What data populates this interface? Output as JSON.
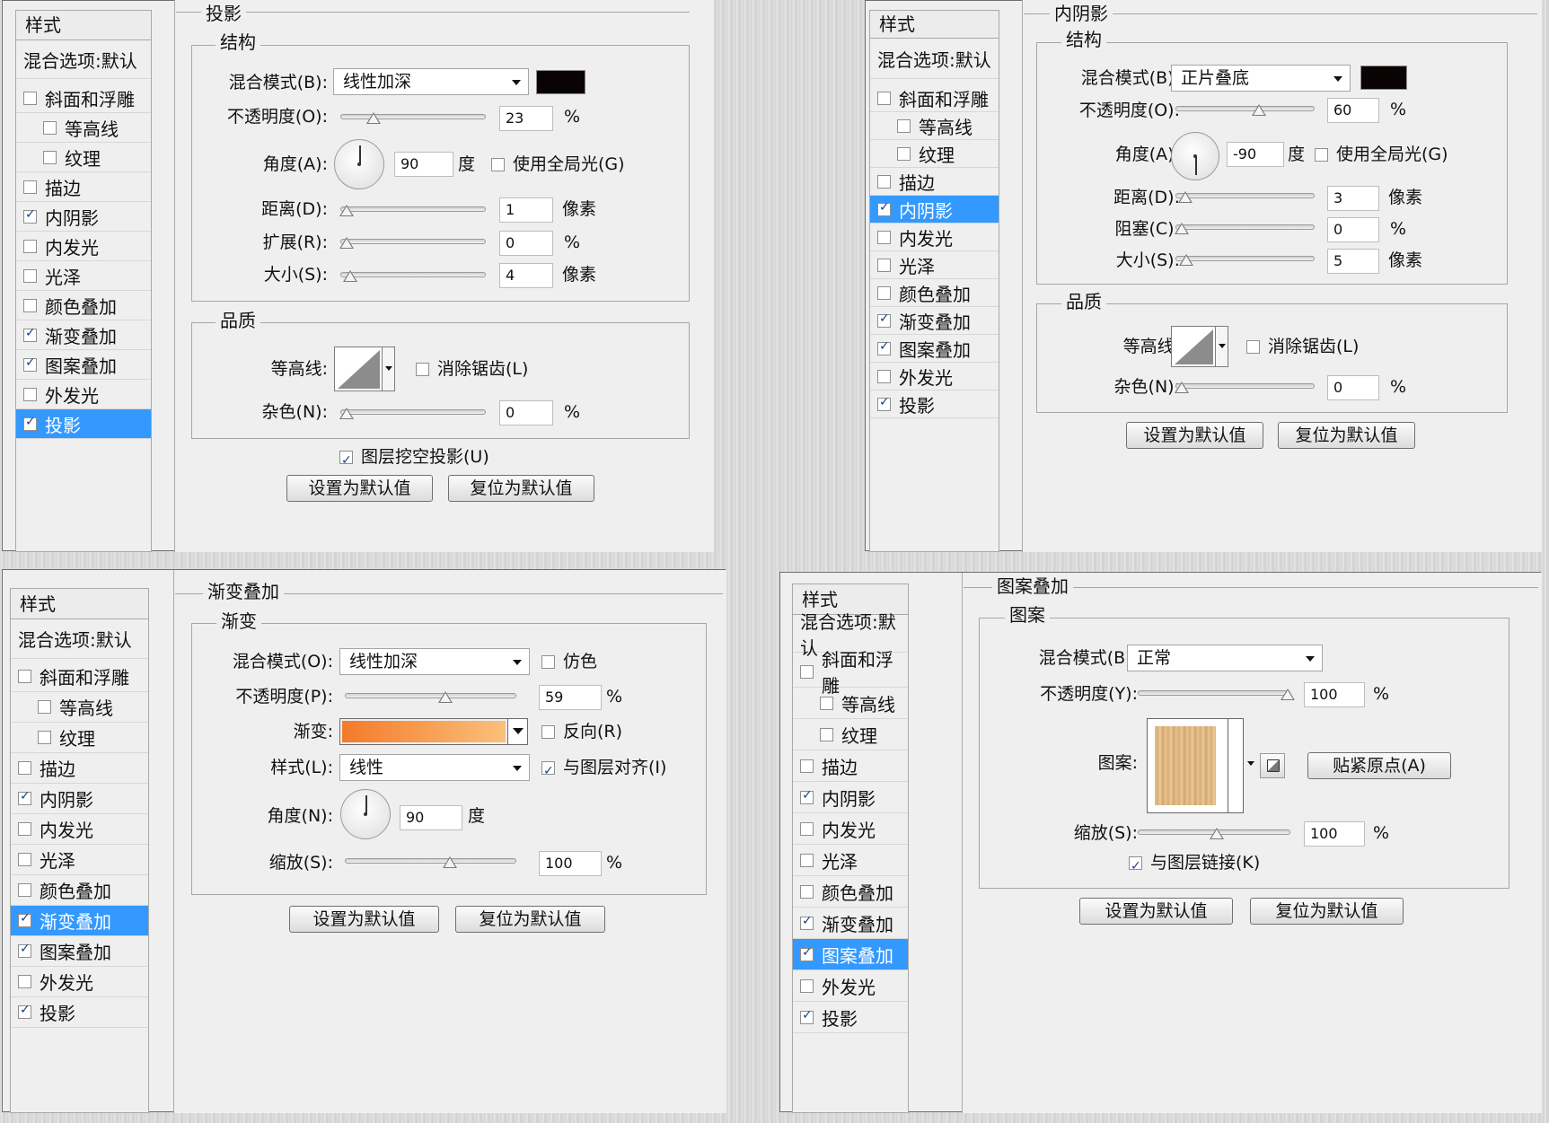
{
  "p1": {
    "sidebar": {
      "header": "样式",
      "blend": "混合选项:默认",
      "items": [
        {
          "label": "斜面和浮雕",
          "checked": false,
          "indent": false,
          "selected": false
        },
        {
          "label": "等高线",
          "checked": false,
          "indent": true,
          "selected": false
        },
        {
          "label": "纹理",
          "checked": false,
          "indent": true,
          "selected": false
        },
        {
          "label": "描边",
          "checked": false,
          "indent": false,
          "selected": false
        },
        {
          "label": "内阴影",
          "checked": true,
          "indent": false,
          "selected": false
        },
        {
          "label": "内发光",
          "checked": false,
          "indent": false,
          "selected": false
        },
        {
          "label": "光泽",
          "checked": false,
          "indent": false,
          "selected": false
        },
        {
          "label": "颜色叠加",
          "checked": false,
          "indent": false,
          "selected": false
        },
        {
          "label": "渐变叠加",
          "checked": true,
          "indent": false,
          "selected": false
        },
        {
          "label": "图案叠加",
          "checked": true,
          "indent": false,
          "selected": false
        },
        {
          "label": "外发光",
          "checked": false,
          "indent": false,
          "selected": false
        },
        {
          "label": "投影",
          "checked": true,
          "indent": false,
          "selected": true
        }
      ]
    },
    "title": "投影",
    "structure": "结构",
    "blend_label": "混合模式(B):",
    "blend_value": "线性加深",
    "opacity_label": "不透明度(O):",
    "opacity": "23",
    "opacity_level": 0.23,
    "pct": "%",
    "angle_label": "角度(A):",
    "angle": "90",
    "deg": "度",
    "global_light": "使用全局光(G)",
    "distance_label": "距离(D):",
    "distance": "1",
    "px": "像素",
    "spread_label": "扩展(R):",
    "spread": "0",
    "size_label": "大小(S):",
    "size": "4",
    "quality": "品质",
    "contour_label": "等高线:",
    "antialias": "消除锯齿(L)",
    "noise_label": "杂色(N):",
    "noise": "0",
    "knockout": "图层挖空投影(U)",
    "btn_default": "设置为默认值",
    "btn_reset": "复位为默认值"
  },
  "p2": {
    "sidebar": {
      "header": "样式",
      "blend": "混合选项:默认",
      "items": [
        {
          "label": "斜面和浮雕",
          "checked": false,
          "indent": false,
          "selected": false
        },
        {
          "label": "等高线",
          "checked": false,
          "indent": true,
          "selected": false
        },
        {
          "label": "纹理",
          "checked": false,
          "indent": true,
          "selected": false
        },
        {
          "label": "描边",
          "checked": false,
          "indent": false,
          "selected": false
        },
        {
          "label": "内阴影",
          "checked": true,
          "indent": false,
          "selected": true
        },
        {
          "label": "内发光",
          "checked": false,
          "indent": false,
          "selected": false
        },
        {
          "label": "光泽",
          "checked": false,
          "indent": false,
          "selected": false
        },
        {
          "label": "颜色叠加",
          "checked": false,
          "indent": false,
          "selected": false
        },
        {
          "label": "渐变叠加",
          "checked": true,
          "indent": false,
          "selected": false
        },
        {
          "label": "图案叠加",
          "checked": true,
          "indent": false,
          "selected": false
        },
        {
          "label": "外发光",
          "checked": false,
          "indent": false,
          "selected": false
        },
        {
          "label": "投影",
          "checked": true,
          "indent": false,
          "selected": false
        }
      ]
    },
    "title": "内阴影",
    "structure": "结构",
    "blend_label": "混合模式(B):",
    "blend_value": "正片叠底",
    "opacity_label": "不透明度(O):",
    "opacity": "60",
    "pct": "%",
    "angle_label": "角度(A):",
    "angle": "-90",
    "deg": "度",
    "global_light": "使用全局光(G)",
    "distance_label": "距离(D):",
    "distance": "3",
    "px": "像素",
    "choke_label": "阻塞(C):",
    "choke": "0",
    "size_label": "大小(S):",
    "size": "5",
    "quality": "品质",
    "contour_label": "等高线:",
    "antialias": "消除锯齿(L)",
    "noise_label": "杂色(N):",
    "noise": "0",
    "btn_default": "设置为默认值",
    "btn_reset": "复位为默认值"
  },
  "p3": {
    "sidebar": {
      "header": "样式",
      "blend": "混合选项:默认",
      "items": [
        {
          "label": "斜面和浮雕",
          "checked": false,
          "indent": false,
          "selected": false
        },
        {
          "label": "等高线",
          "checked": false,
          "indent": true,
          "selected": false
        },
        {
          "label": "纹理",
          "checked": false,
          "indent": true,
          "selected": false
        },
        {
          "label": "描边",
          "checked": false,
          "indent": false,
          "selected": false
        },
        {
          "label": "内阴影",
          "checked": true,
          "indent": false,
          "selected": false
        },
        {
          "label": "内发光",
          "checked": false,
          "indent": false,
          "selected": false
        },
        {
          "label": "光泽",
          "checked": false,
          "indent": false,
          "selected": false
        },
        {
          "label": "颜色叠加",
          "checked": false,
          "indent": false,
          "selected": false
        },
        {
          "label": "渐变叠加",
          "checked": true,
          "indent": false,
          "selected": true
        },
        {
          "label": "图案叠加",
          "checked": true,
          "indent": false,
          "selected": false
        },
        {
          "label": "外发光",
          "checked": false,
          "indent": false,
          "selected": false
        },
        {
          "label": "投影",
          "checked": true,
          "indent": false,
          "selected": false
        }
      ]
    },
    "title": "渐变叠加",
    "section": "渐变",
    "blend_label": "混合模式(O):",
    "blend_value": "线性加深",
    "dither": "仿色",
    "opacity_label": "不透明度(P):",
    "opacity": "59",
    "pct": "%",
    "gradient_label": "渐变:",
    "reverse": "反向(R)",
    "style_label": "样式(L):",
    "style_value": "线性",
    "align": "与图层对齐(I)",
    "angle_label": "角度(N):",
    "angle": "90",
    "deg": "度",
    "scale_label": "缩放(S):",
    "scale": "100",
    "btn_default": "设置为默认值",
    "btn_reset": "复位为默认值"
  },
  "p4": {
    "sidebar": {
      "header": "样式",
      "blend": "混合选项:默认",
      "items": [
        {
          "label": "斜面和浮雕",
          "checked": false,
          "indent": false,
          "selected": false
        },
        {
          "label": "等高线",
          "checked": false,
          "indent": true,
          "selected": false
        },
        {
          "label": "纹理",
          "checked": false,
          "indent": true,
          "selected": false
        },
        {
          "label": "描边",
          "checked": false,
          "indent": false,
          "selected": false
        },
        {
          "label": "内阴影",
          "checked": true,
          "indent": false,
          "selected": false
        },
        {
          "label": "内发光",
          "checked": false,
          "indent": false,
          "selected": false
        },
        {
          "label": "光泽",
          "checked": false,
          "indent": false,
          "selected": false
        },
        {
          "label": "颜色叠加",
          "checked": false,
          "indent": false,
          "selected": false
        },
        {
          "label": "渐变叠加",
          "checked": true,
          "indent": false,
          "selected": false
        },
        {
          "label": "图案叠加",
          "checked": true,
          "indent": false,
          "selected": true
        },
        {
          "label": "外发光",
          "checked": false,
          "indent": false,
          "selected": false
        },
        {
          "label": "投影",
          "checked": true,
          "indent": false,
          "selected": false
        }
      ]
    },
    "title": "图案叠加",
    "section": "图案",
    "blend_label": "混合模式(B):",
    "blend_value": "正常",
    "opacity_label": "不透明度(Y):",
    "opacity": "100",
    "pct": "%",
    "pattern_label": "图案:",
    "snap": "贴紧原点(A)",
    "scale_label": "缩放(S):",
    "scale": "100",
    "link": "与图层链接(K)",
    "btn_default": "设置为默认值",
    "btn_reset": "复位为默认值"
  },
  "colors": {
    "selected": "#3399ff",
    "shadow_color": "#0a0303",
    "gradient_from": "#f47a2a",
    "gradient_to": "#fbc07a"
  }
}
